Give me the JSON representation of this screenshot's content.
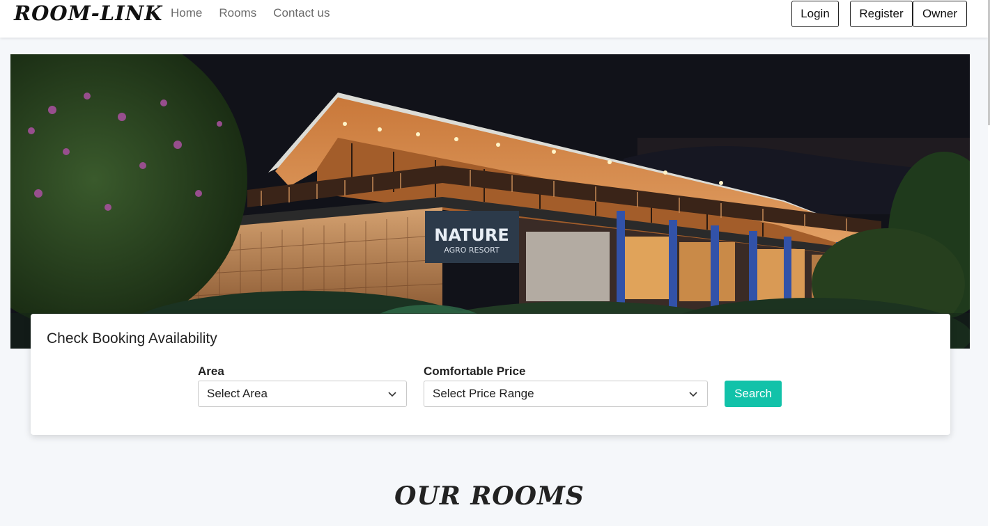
{
  "brand": "ROOM-LINK",
  "nav": {
    "links": [
      "Home",
      "Rooms",
      "Contact us"
    ]
  },
  "auth": {
    "login": "Login",
    "register": "Register",
    "owner": "Owner"
  },
  "hero": {
    "sign_title": "NATURE",
    "sign_subtitle": "AGRO RESORT"
  },
  "booking": {
    "title": "Check Booking Availability",
    "area_label": "Area",
    "area_value": "Select Area",
    "price_label": "Comfortable Price",
    "price_value": "Select Price Range",
    "search_label": "Search"
  },
  "rooms_title": "OUR ROOMS",
  "colors": {
    "accent": "#12c2a9",
    "page_bg": "#f5f7fa"
  }
}
